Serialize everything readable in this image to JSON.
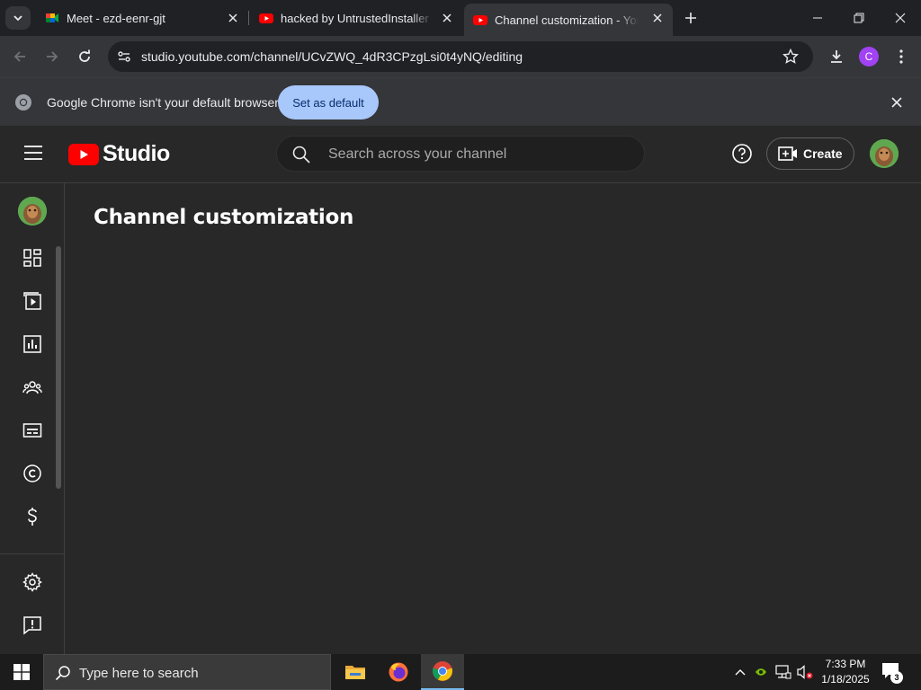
{
  "browser": {
    "tabs": [
      {
        "title": "Meet - ezd-eenr-gjt",
        "favicon": "google-meet-icon",
        "active": false
      },
      {
        "title": "hacked by UntrustedInstaller - YouTube",
        "favicon": "youtube-icon",
        "active": false
      },
      {
        "title": "Channel customization - YouTube Studio",
        "favicon": "youtube-icon",
        "active": true
      }
    ],
    "url": "studio.youtube.com/channel/UCvZWQ_4dR3CPzgLsi0t4yNQ/editing",
    "profile_initial": "C",
    "infobar": {
      "message": "Google Chrome isn't your default browser",
      "button": "Set as default"
    }
  },
  "studio": {
    "logo_text": "Studio",
    "search_placeholder": "Search across your channel",
    "create_label": "Create",
    "page_title": "Channel customization",
    "nav_items": [
      "dashboard-icon",
      "content-icon",
      "analytics-icon",
      "community-icon",
      "subtitles-icon",
      "copyright-icon",
      "earn-icon",
      "settings-icon",
      "feedback-icon"
    ]
  },
  "taskbar": {
    "search_placeholder": "Type here to search",
    "time": "7:33 PM",
    "date": "1/18/2025",
    "notification_count": "3"
  },
  "colors": {
    "yt_red": "#ff0000",
    "accent_blue": "#a8c7fa",
    "profile_purple": "#a142f4"
  }
}
